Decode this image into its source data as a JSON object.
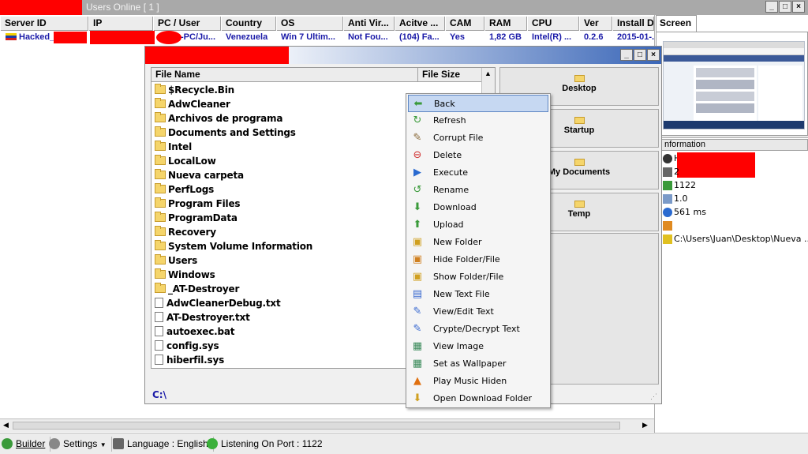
{
  "window": {
    "title": "Users Online [ 1 ]",
    "btn_min": "_",
    "btn_max": "□",
    "btn_close": "×"
  },
  "table": {
    "headers": [
      "Server ID",
      "IP",
      "PC / User",
      "Country",
      "OS",
      "Anti Vir...",
      "Acitve ...",
      "CAM",
      "RAM",
      "CPU",
      "Ver",
      "Install D"
    ],
    "row": [
      "Hacked_",
      "",
      "-PC/Ju...",
      "Venezuela",
      "Win 7 Ultim...",
      "Not Fou...",
      "(104) Fa...",
      "Yes",
      "1,82 GB",
      "Intel(R) ...",
      "0.2.6",
      "2015-01-..."
    ]
  },
  "side": {
    "screen_label": "Screen",
    "info_label": "nformation",
    "info": [
      "H",
      "2",
      "1122",
      "1.0",
      "561 ms",
      "",
      "C:\\Users\\Juan\\Desktop\\Nueva ..."
    ]
  },
  "fm": {
    "col_name": "File Name",
    "col_size": "File Size",
    "files": [
      {
        "name": "$Recycle.Bin",
        "kind": "folder"
      },
      {
        "name": "AdwCleaner",
        "kind": "folder"
      },
      {
        "name": "Archivos de programa",
        "kind": "folder"
      },
      {
        "name": "Documents and Settings",
        "kind": "folder"
      },
      {
        "name": "Intel",
        "kind": "folder"
      },
      {
        "name": "LocalLow",
        "kind": "folder"
      },
      {
        "name": "Nueva carpeta",
        "kind": "folder"
      },
      {
        "name": "PerfLogs",
        "kind": "folder"
      },
      {
        "name": "Program Files",
        "kind": "folder"
      },
      {
        "name": "ProgramData",
        "kind": "folder"
      },
      {
        "name": "Recovery",
        "kind": "folder"
      },
      {
        "name": "System Volume Information",
        "kind": "folder"
      },
      {
        "name": "Users",
        "kind": "folder"
      },
      {
        "name": "Windows",
        "kind": "folder"
      },
      {
        "name": "_AT-Destroyer",
        "kind": "folder"
      },
      {
        "name": "AdwCleanerDebug.txt",
        "kind": "file"
      },
      {
        "name": "AT-Destroyer.txt",
        "kind": "file"
      },
      {
        "name": "autoexec.bat",
        "kind": "file"
      },
      {
        "name": "config.sys",
        "kind": "file"
      },
      {
        "name": "hiberfil.sys",
        "kind": "file"
      }
    ],
    "quick": [
      "Desktop",
      "Startup",
      "My Documents",
      "Temp"
    ],
    "path": "C:\\"
  },
  "menu": [
    {
      "label": "Back",
      "icon": "back-arrow-icon",
      "glyph": "⬅",
      "color": "#3a9a3a"
    },
    {
      "label": "Refresh",
      "icon": "refresh-icon",
      "glyph": "↻",
      "color": "#3a9a3a"
    },
    {
      "label": "Corrupt File",
      "icon": "pen-icon",
      "glyph": "✎",
      "color": "#8a6a3a"
    },
    {
      "label": "Delete",
      "icon": "delete-icon",
      "glyph": "⊖",
      "color": "#d03030"
    },
    {
      "label": "Execute",
      "icon": "execute-icon",
      "glyph": "▶",
      "color": "#2a6ad0"
    },
    {
      "label": "Rename",
      "icon": "rename-icon",
      "glyph": "↺",
      "color": "#3a9a3a"
    },
    {
      "label": "Download",
      "icon": "download-icon",
      "glyph": "⬇",
      "color": "#3a9a3a"
    },
    {
      "label": "Upload",
      "icon": "upload-icon",
      "glyph": "⬆",
      "color": "#3a9a3a"
    },
    {
      "label": "New Folder",
      "icon": "new-folder-icon",
      "glyph": "▣",
      "color": "#d0a020"
    },
    {
      "label": "Hide Folder/File",
      "icon": "hide-folder-icon",
      "glyph": "▣",
      "color": "#d08020"
    },
    {
      "label": "Show Folder/File",
      "icon": "show-folder-icon",
      "glyph": "▣",
      "color": "#d0a020"
    },
    {
      "label": "New Text File",
      "icon": "text-file-icon",
      "glyph": "▤",
      "color": "#3a6ad0"
    },
    {
      "label": "View/Edit Text",
      "icon": "edit-text-icon",
      "glyph": "✎",
      "color": "#3a6ad0"
    },
    {
      "label": "Crypte/Decrypt Text",
      "icon": "crypt-icon",
      "glyph": "✎",
      "color": "#3a6ad0"
    },
    {
      "label": "View Image",
      "icon": "image-icon",
      "glyph": "▦",
      "color": "#3a8a5a"
    },
    {
      "label": "Set as Wallpaper",
      "icon": "wallpaper-icon",
      "glyph": "▦",
      "color": "#3a8a5a"
    },
    {
      "label": "Play Music Hiden",
      "icon": "vlc-icon",
      "glyph": "▲",
      "color": "#e07010"
    },
    {
      "label": "Open Download Folder",
      "icon": "download-folder-icon",
      "glyph": "⬇",
      "color": "#d0a020"
    }
  ],
  "status": {
    "builder": "Builder",
    "settings": "Settings",
    "language": "Language : English",
    "listening": "Listening On Port : 1122"
  },
  "colors": {
    "accent": "#1a1aa8",
    "redact": "#ff0000",
    "selection": "#c6d8f2"
  }
}
